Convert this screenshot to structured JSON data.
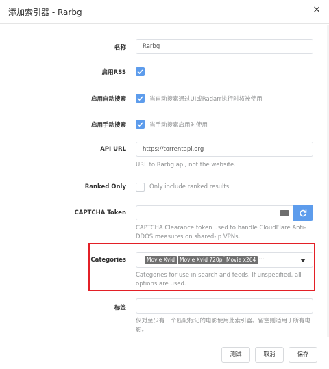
{
  "dialog": {
    "title": "添加索引器 - Rarbg",
    "close_label": "×"
  },
  "fields": {
    "name": {
      "label": "名称",
      "value": "Rarbg"
    },
    "enable_rss": {
      "label": "启用RSS",
      "checked": true
    },
    "enable_auto_search": {
      "label": "启用自动搜索",
      "checked": true,
      "help": "当自动搜索通过UI或Radarr执行时将被使用"
    },
    "enable_interactive_search": {
      "label": "启用手动搜索",
      "checked": true,
      "help": "当手动搜索启用时使用"
    },
    "api_url": {
      "label": "API URL",
      "value": "https://torrentapi.org",
      "help": "URL to Rarbg api, not the website."
    },
    "ranked_only": {
      "label": "Ranked Only",
      "checked": false,
      "help": "Only include ranked results."
    },
    "captcha_token": {
      "label": "CAPTCHA Token",
      "value": "",
      "help": "CAPTCHA Clearance token used to handle CloudFlare Anti-DDOS measures on shared-ip VPNs."
    },
    "categories": {
      "label": "Categories",
      "selected": [
        "Movie Xvid",
        "Movie Xvid 720p",
        "Movie x264"
      ],
      "overflow": "...",
      "help": "Categories for use in search and feeds. If unspecified, all options are used."
    },
    "tags": {
      "label": "标签",
      "value": "",
      "help": "仅对至少有一个匹配标记的电影使用此索引器。留空则适用于所有电影。"
    }
  },
  "footer": {
    "test_label": "测试",
    "cancel_label": "取消",
    "save_label": "保存"
  },
  "colors": {
    "accent": "#5d9cec",
    "highlight_border": "#e32027",
    "tag_bg": "#707070",
    "help_text": "#909293"
  },
  "icons": {
    "close": "close-icon",
    "check": "checkmark-icon",
    "keyboard": "keyboard-icon",
    "refresh": "refresh-icon",
    "dropdown": "caret-down-icon"
  }
}
